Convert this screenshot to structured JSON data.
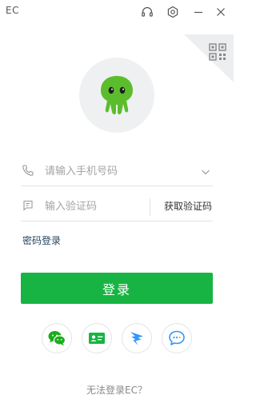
{
  "window": {
    "title": "EC"
  },
  "login": {
    "phone_placeholder": "请输入手机号码",
    "code_placeholder": "输入验证码",
    "get_code": "获取验证码",
    "password_login": "密码登录",
    "login_button": "登录",
    "cannot_login": "无法登录EC？"
  },
  "colors": {
    "primary_green": "#17b443",
    "avatar_bg": "#eef0f2",
    "wechat_green": "#1aad19",
    "card_green": "#17b443",
    "dingtalk_blue": "#3296fa",
    "link_text": "#26445f"
  },
  "icons": {
    "titlebar": [
      "headset-icon",
      "settings-icon",
      "minimize-icon",
      "close-icon"
    ],
    "social": [
      "wechat-icon",
      "business-card-icon",
      "dingtalk-icon",
      "message-icon"
    ]
  }
}
